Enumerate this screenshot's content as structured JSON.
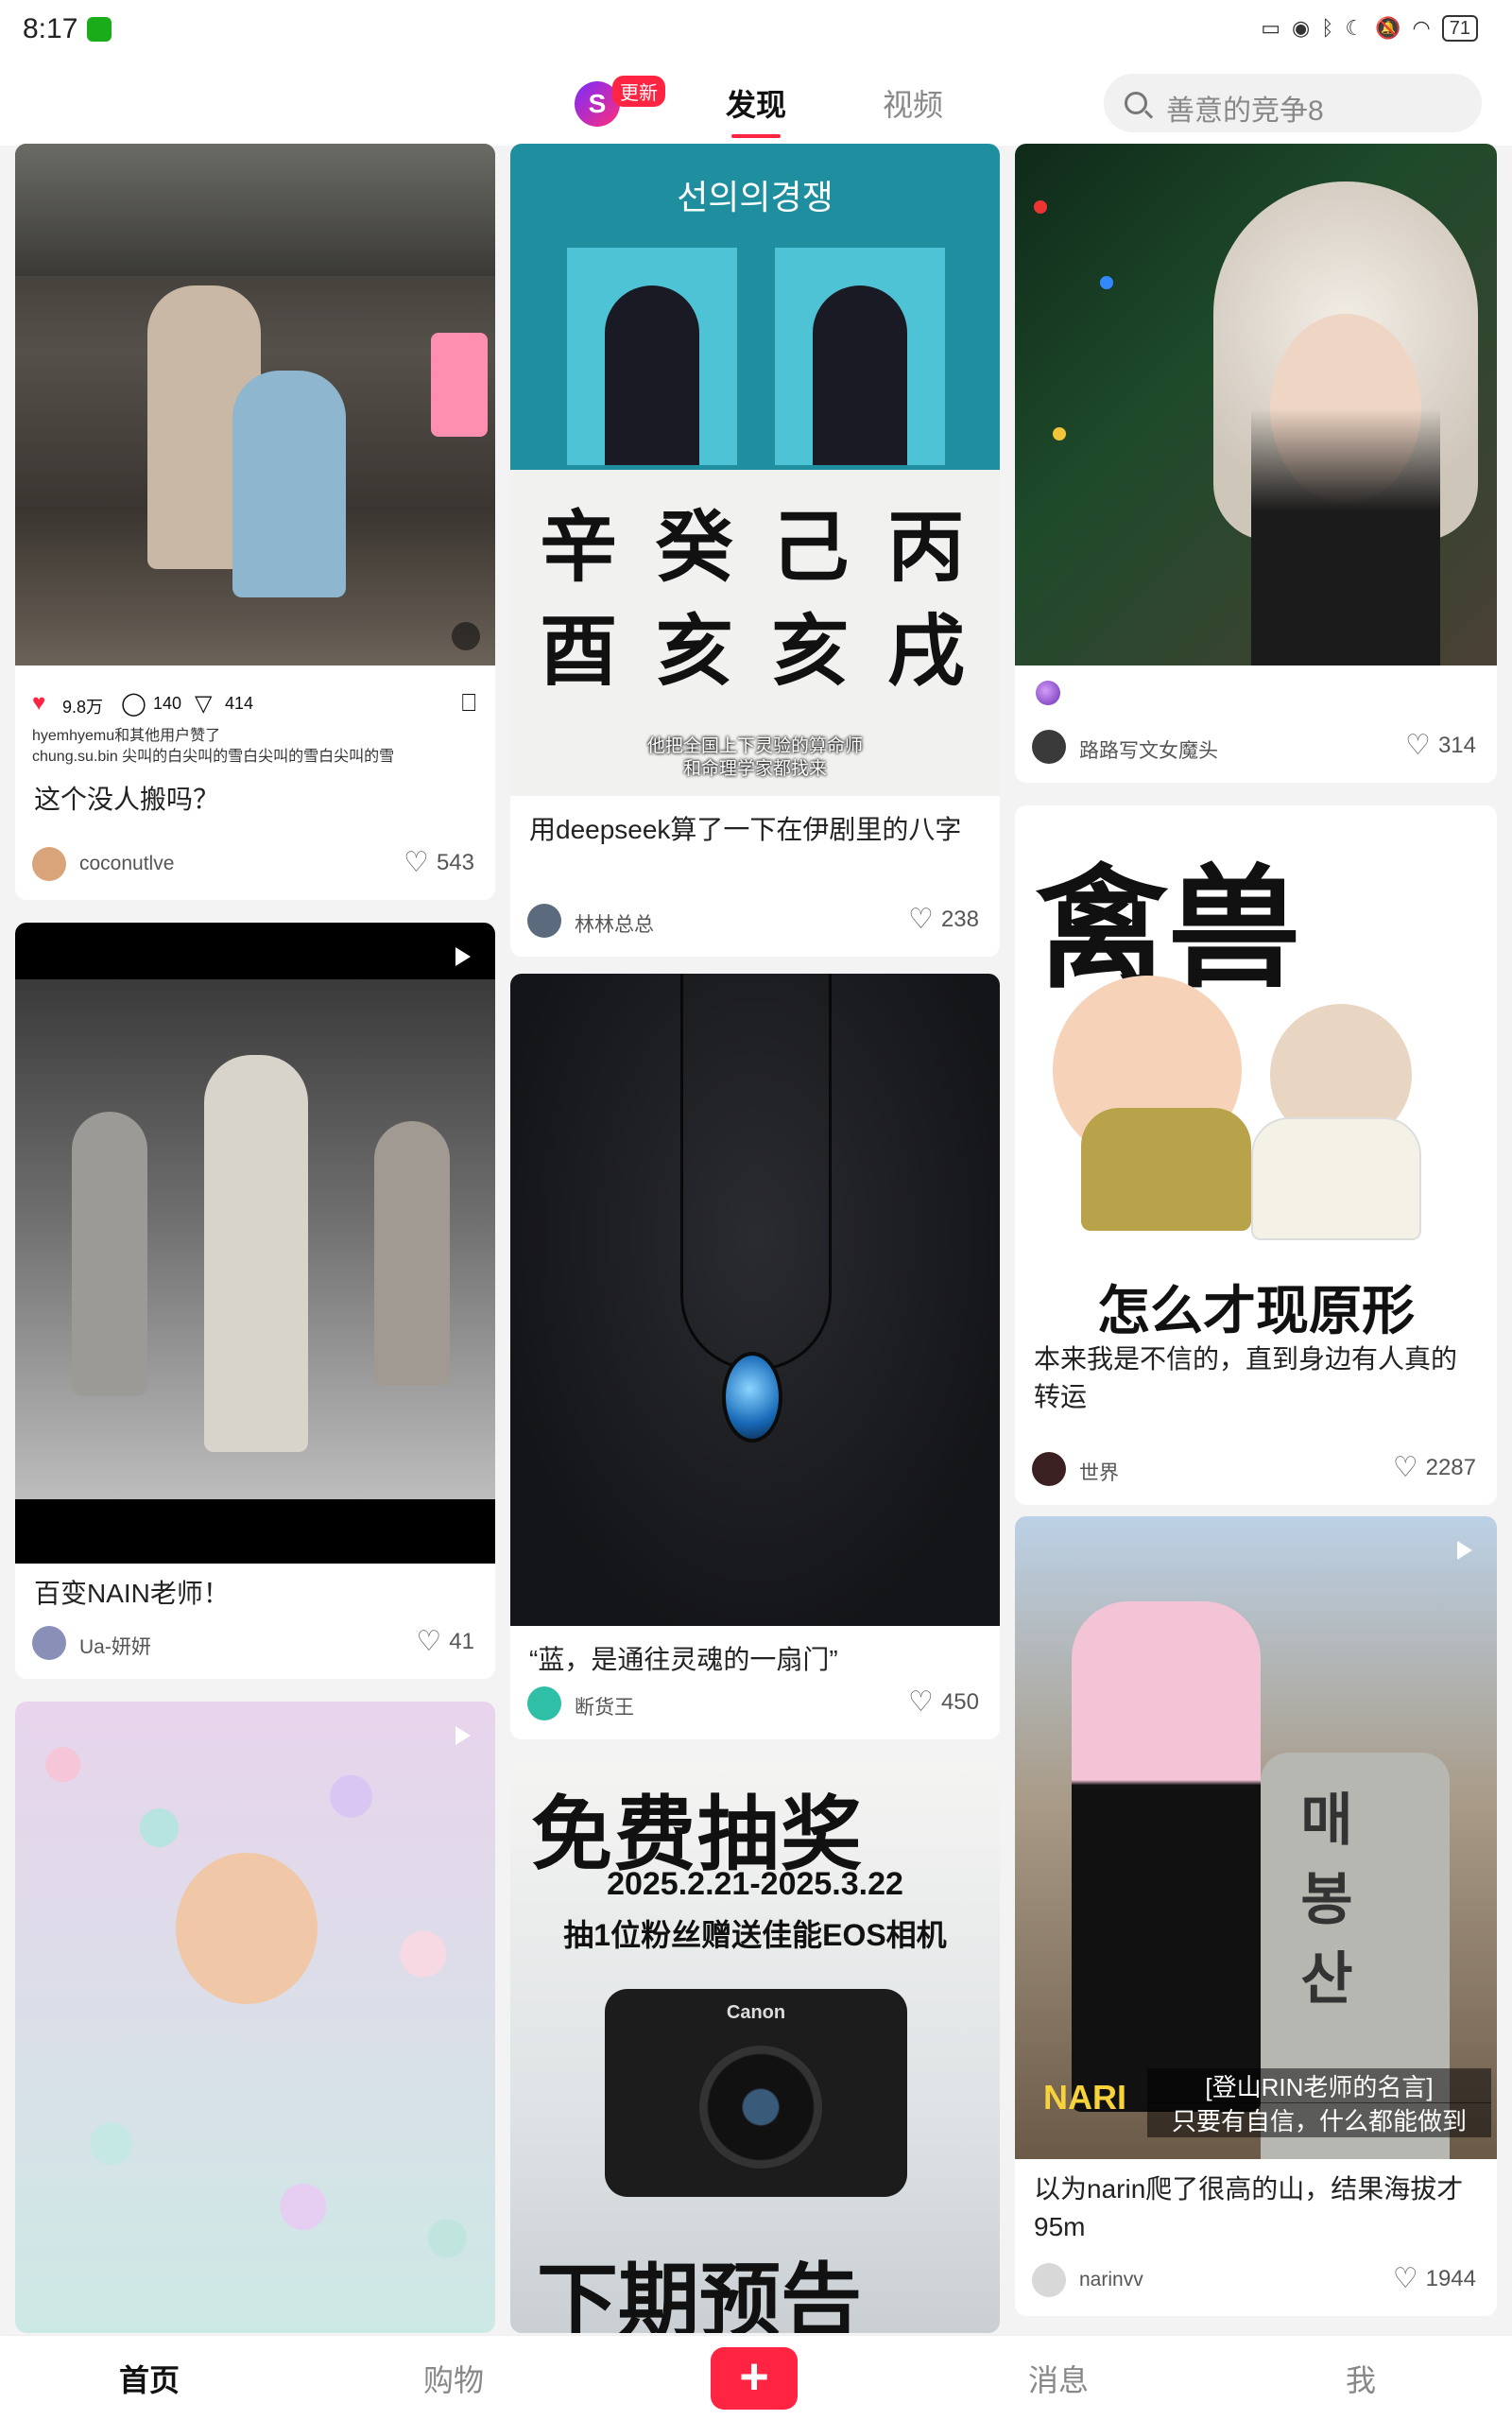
{
  "status": {
    "time": "8:17",
    "battery": "71"
  },
  "header": {
    "brand_glyph": "S",
    "badge": "更新",
    "tabs": [
      "发现",
      "视频"
    ],
    "search_placeholder": "善意的竞争8"
  },
  "cards": {
    "c1": {
      "inner_likes": "9.8万",
      "inner_comments": "140",
      "inner_shares": "414",
      "inner_line1": "hyemhyemu和其他用户赞了",
      "inner_line2": "chung.su.bin 尖叫的白尖叫的雪白尖叫的雪白尖叫的雪",
      "title": "这个没人搬吗？",
      "user": "coconutlve",
      "likes": "543"
    },
    "c2": {
      "banner": "선의의경쟁",
      "calligraphy_row1": "辛 癸 己 丙",
      "calligraphy_row2": "酉 亥 亥 戌",
      "subtitle1": "他把全国上下灵验的算命师",
      "subtitle2": "和命理学家都找来",
      "title": "用deepseek算了一下在伊剧里的八字",
      "user": "林林总总",
      "likes": "238"
    },
    "c3": {
      "title": "",
      "user": "路路写文女魔头",
      "likes": "314"
    },
    "c4": {
      "title": "百变NAIN老师！",
      "user": "Ua-妍妍",
      "likes": "41"
    },
    "c5": {
      "title": "“蓝，是通往灵魂的一扇门”",
      "user": "断货王",
      "likes": "450"
    },
    "c6": {
      "big_text": "禽兽",
      "bottom_text": "怎么才现原形",
      "title": "本来我是不信的，直到身边有人真的转运",
      "user": "世界",
      "likes": "2287"
    },
    "c8": {
      "headline": "免费抽奖",
      "dates": "2025.2.21-2025.3.22",
      "prize": "抽1位粉丝赠送佳能EOS相机",
      "brand": "Canon",
      "footer": "下期预告"
    },
    "c9": {
      "stone_text": "매봉산",
      "caption_tag": "NARI",
      "caption1": "[登山RIN老师的名言]",
      "caption2": "只要有自信，什么都能做到",
      "title": "以为narin爬了很高的山，结果海拔才95m",
      "user": "narinvv",
      "likes": "1944"
    }
  },
  "nav": {
    "home": "首页",
    "shop": "购物",
    "plus": "+",
    "messages": "消息",
    "me": "我"
  },
  "colors": {
    "accent": "#ff2442",
    "background": "#f3f3f3"
  }
}
